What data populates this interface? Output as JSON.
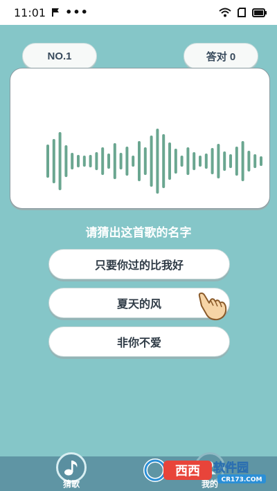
{
  "status_bar": {
    "time": "11:01",
    "more": "•••"
  },
  "header": {
    "level_label": "NO.1",
    "score_label": "答对 0"
  },
  "colors": {
    "background": "#85c6c8",
    "wave": "#6aa690",
    "card": "#ffffff",
    "nav": "#5f95a4"
  },
  "prompt": "请猜出这首歌的名字",
  "options": [
    {
      "label": "只要你过的比我好"
    },
    {
      "label": "夏天的风"
    },
    {
      "label": "非你不爱"
    }
  ],
  "bottom_nav": [
    {
      "label": "猜歌",
      "icon": "music-note-icon"
    },
    {
      "label": "我的",
      "icon": "user-icon"
    }
  ],
  "watermark": {
    "brand": "西西软件园",
    "site": "CR173.COM"
  }
}
